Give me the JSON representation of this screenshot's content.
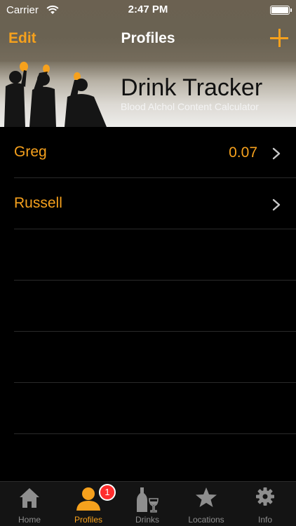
{
  "status_bar": {
    "carrier": "Carrier",
    "time": "2:47 PM",
    "wifi_icon": "wifi-icon",
    "battery_icon": "battery-icon"
  },
  "nav": {
    "edit_label": "Edit",
    "title": "Profiles",
    "add_icon": "plus-icon"
  },
  "banner": {
    "title": "Drink Tracker",
    "subtitle": "Blood Alchol Content Calculator"
  },
  "profiles": [
    {
      "name": "Greg",
      "value": "0.07"
    },
    {
      "name": "Russell",
      "value": ""
    }
  ],
  "tab_bar": {
    "tabs": [
      {
        "label": "Home",
        "icon": "home-icon",
        "active": false
      },
      {
        "label": "Profiles",
        "icon": "person-icon",
        "active": true,
        "badge": "1"
      },
      {
        "label": "Drinks",
        "icon": "bottle-glass-icon",
        "active": false
      },
      {
        "label": "Locations",
        "icon": "star-icon",
        "active": false
      },
      {
        "label": "Info",
        "icon": "gear-icon",
        "active": false
      }
    ]
  },
  "colors": {
    "accent": "#f6a11d",
    "background": "#000000",
    "badge": "#ff2d2d"
  }
}
